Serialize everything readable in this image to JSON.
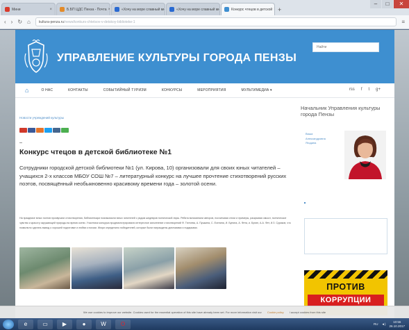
{
  "browser": {
    "tabs": [
      {
        "label": "Мини",
        "color": "#d93a2b",
        "active": false
      },
      {
        "label": "Б.БП ЦДС Пенза - Почта",
        "color": "#e38b2a",
        "active": false
      },
      {
        "label": "«Хочу на море славный мне»",
        "color": "#2a6ad1",
        "active": false
      },
      {
        "label": "«Хочу на море славный мне»",
        "color": "#2a6ad1",
        "active": false
      },
      {
        "label": "Конкурс чтецов в детской",
        "color": "#3e8fd0",
        "active": true
      }
    ],
    "url_host": "kultura-penza.ru",
    "url_path": "/news/konkurs-chtetsov-v-detskoy-biblioteke-1"
  },
  "site": {
    "title": "УПРАВЛЕНИЕ КУЛЬТУРЫ ГОРОДА ПЕНЗЫ",
    "search_placeholder": "Найти"
  },
  "nav": {
    "items": [
      "О НАС",
      "КОНТАКТЫ",
      "СОБЫТИЙНЫЙ ТУРИЗМ",
      "КОНКУРСЫ",
      "МЕРОПРИЯТИЯ",
      "МУЛЬТИМЕДИА ▾"
    ],
    "social": [
      "rss",
      "f",
      "t",
      "g+"
    ]
  },
  "article": {
    "breadcrumb": "Новости учреждений культуры",
    "share_colors": [
      "#d0392a",
      "#3b5998",
      "#e5742b",
      "#1da1f2",
      "#45668e",
      "#4caf50"
    ],
    "title": "Конкурс чтецов в детской библиотеке №1",
    "lead": "Сотрудники городской детской библиотеки №1 (ул. Кирова, 10) организовали для своих юных читателей – учащихся 2-х классов МБОУ СОШ №7 – литературный конкурс на лучшее прочтение стихотворений русских поэтов, посвящённый необыкновенно красивому времени года – золотой осени.",
    "body": "На празднике юных поэтов прозвучали стихотворения, библиотекари познакомили юных читателей с рядом шедевров поэтической лиры. Ребята вспоминали авторов, посчитывая стихи и примеры, раскрывая смысл, поэтическое чувство и красоту окружающей природы во время осени. Участники конкурса продемонстрировали интересное исполнение стихотворений Ф. Тютчева, А. Пушкина, С. Есенина, И. Бунина, А. Фета, и. Бунин, А.А. Фет, И.З. Суриков, что позволило сделать вывод о хорошей подготовке и любви к поэзии. Жюри определило победителей, которые были награждены дипломами и подарками."
  },
  "sidebar": {
    "title": "Начальник Управления культуры города Пензы",
    "links": [
      "Ваша",
      "Александровна",
      "Ягодина"
    ]
  },
  "banner": {
    "line1": "ПРОТИВ",
    "line2": "КОРРУПЦИИ"
  },
  "cookie": {
    "text": "We use cookies to improve our website. Cookies used for the essential operation of this site have already been set. For more information visit our",
    "link": "Cookie policy",
    "accept": "I accept cookies from this site"
  },
  "taskbar": {
    "lang": "RU",
    "time": "10:56",
    "date": "26.10.2017"
  }
}
